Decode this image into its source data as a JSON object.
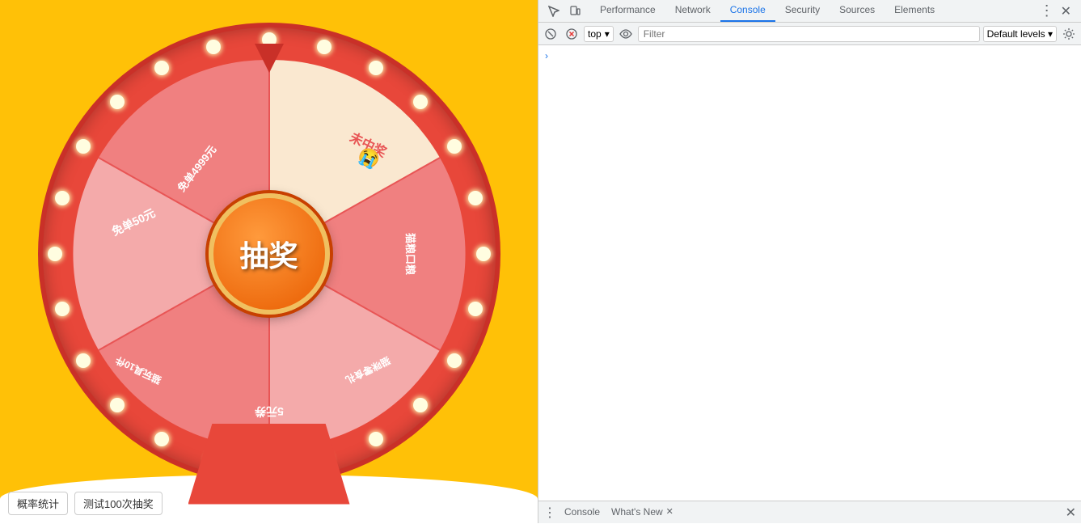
{
  "left": {
    "center_btn_label": "抽奖",
    "btn_probability": "概率统计",
    "btn_test": "测试100次抽奖",
    "segments": [
      {
        "label": "未中奖",
        "emoji": "😭",
        "color": "#fdf0e0"
      },
      {
        "label": "猫粮口粮",
        "color": "#f4a0a0"
      },
      {
        "label": "猫咪零食礼",
        "color": "#f4a0a0"
      },
      {
        "label": "5元券",
        "color": "#f4a0a0"
      },
      {
        "label": "猫玩具10件",
        "color": "#f4a0a0"
      },
      {
        "label": "免单50元",
        "color": "#f4c0b0"
      },
      {
        "label": "免单4999元",
        "color": "#f4c0b0"
      }
    ]
  },
  "devtools": {
    "tabs": [
      {
        "label": "Performance",
        "active": false
      },
      {
        "label": "Network",
        "active": false
      },
      {
        "label": "Console",
        "active": true
      },
      {
        "label": "Security",
        "active": false
      },
      {
        "label": "Sources",
        "active": false
      },
      {
        "label": "Elements",
        "active": false
      }
    ],
    "console_toolbar": {
      "context": "top",
      "filter_placeholder": "Filter",
      "default_levels": "Default levels ▾"
    },
    "bottom_tabs": [
      {
        "label": "Console",
        "closable": false
      },
      {
        "label": "What's New",
        "closable": true
      }
    ]
  }
}
